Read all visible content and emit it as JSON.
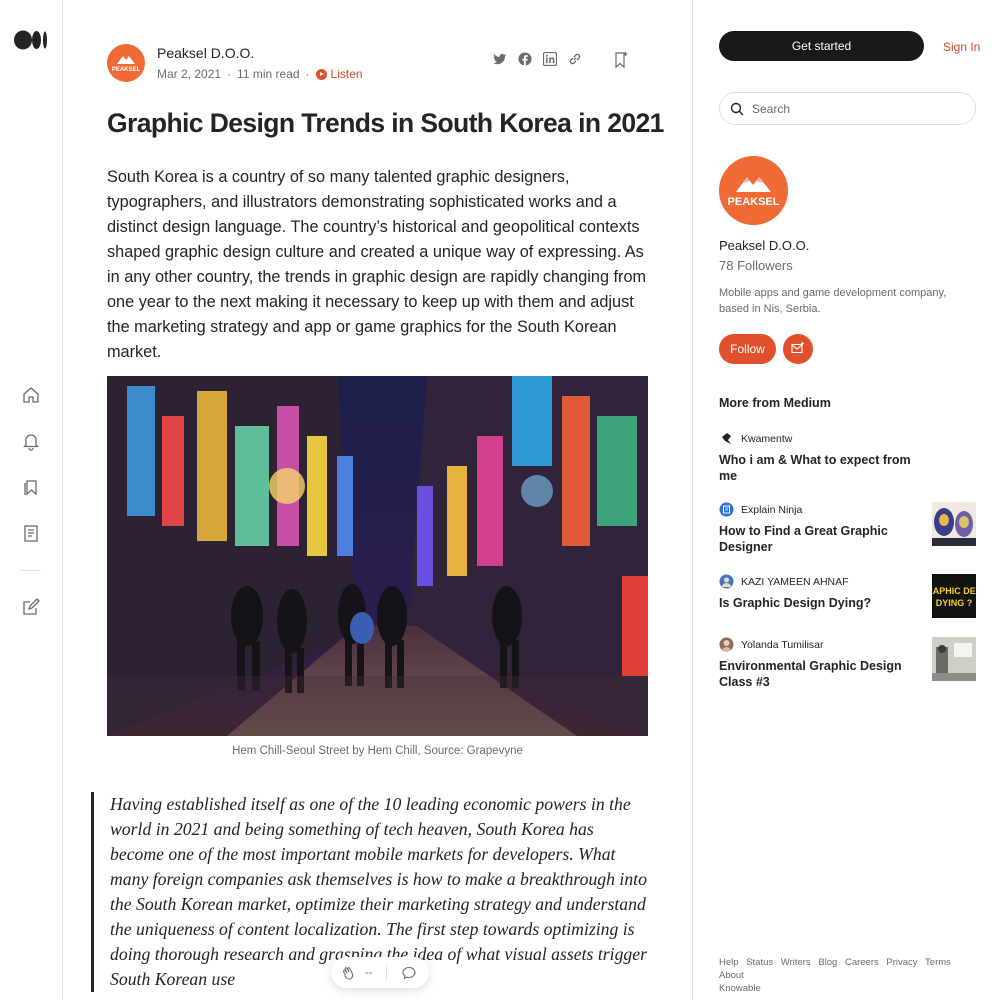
{
  "nav": {
    "logo": "medium-logo",
    "icons": [
      "home-icon",
      "notifications-icon",
      "lists-icon",
      "stories-icon",
      "write-icon"
    ]
  },
  "article": {
    "author": "Peaksel D.O.O.",
    "date": "Mar 2, 2021",
    "read_time": "11 min read",
    "listen_label": "Listen",
    "title": "Graphic Design Trends in South Korea in 2021",
    "lead": "South Korea is a country of so many talented graphic designers, typographers, and illustrators demonstrating sophisticated works and a distinct design language. The country’s historical and geopolitical contexts shaped graphic design culture and created a unique way of expressing. As in any other country, the trends in graphic design are rapidly changing from one year to the next making it necessary to keep up with them and adjust the marketing strategy and app or game graphics for the South Korean market.",
    "image_caption": "Hem Chill-Seoul Street by Hem Chill, Source: Grapevyne",
    "quote": "Having established itself as one of the 10 leading economic powers in the world in 2021 and being something of tech heaven, South Korea has become one of the most important mobile markets for developers. What many foreign companies ask themselves is how to make a breakthrough into the South Korean market, optimize their marketing strategy and understand the uniqueness of content localization. The first step towards optimizing is doing thorough research and grasping the idea of what visual assets trigger South Korean use",
    "clap_count": "--",
    "avatar_text": "PEAKSEL"
  },
  "sidebar": {
    "get_started": "Get started",
    "sign_in": "Sign In",
    "search_placeholder": "Search",
    "publisher": {
      "name": "Peaksel D.O.O.",
      "followers": "78 Followers",
      "description": "Mobile apps and game development company, based in Nis, Serbia.",
      "follow_label": "Follow",
      "avatar_text": "PEAKSEL"
    },
    "more_heading": "More from Medium",
    "recommendations": [
      {
        "author": "Kwamentw",
        "title": "Who i am & What to expect from me"
      },
      {
        "author": "Explain Ninja",
        "title": "How to Find a Great Graphic Designer"
      },
      {
        "author": "KAZI YAMEEN AHNAF",
        "title": "Is Graphic Design Dying?",
        "thumb_text": "RAPHIC DES DYING ?"
      },
      {
        "author": "Yolanda Tumilisar",
        "title": "Environmental Graphic Design Class #3"
      }
    ],
    "footer_links": [
      "Help",
      "Status",
      "Writers",
      "Blog",
      "Careers",
      "Privacy",
      "Terms",
      "About",
      "Knowable"
    ]
  },
  "colors": {
    "accent": "#e0502c",
    "avatar_orange": "#f06a35",
    "dark": "#191919"
  }
}
